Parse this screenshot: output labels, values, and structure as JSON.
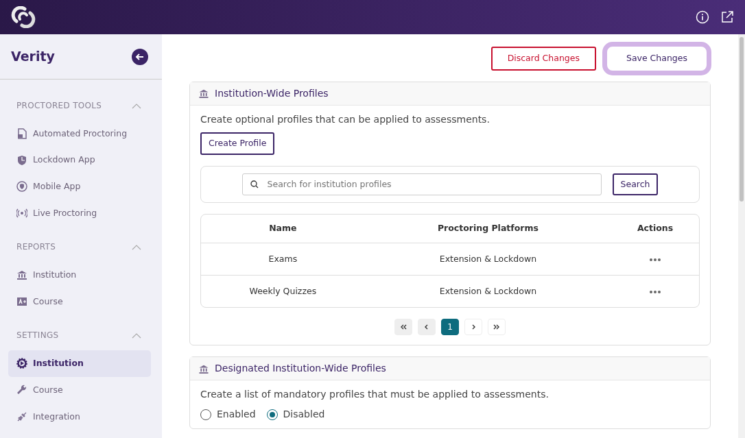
{
  "sidebar": {
    "title": "Verity",
    "sections": [
      {
        "heading": "PROCTORED TOOLS",
        "expanded": true,
        "items": [
          {
            "label": "Automated Proctoring",
            "selected": false
          },
          {
            "label": "Lockdown App",
            "selected": false
          },
          {
            "label": "Mobile App",
            "selected": false
          },
          {
            "label": "Live Proctoring",
            "selected": false
          }
        ]
      },
      {
        "heading": "REPORTS",
        "expanded": true,
        "items": [
          {
            "label": "Institution",
            "selected": false
          },
          {
            "label": "Course",
            "selected": false
          }
        ]
      },
      {
        "heading": "SETTINGS",
        "expanded": true,
        "items": [
          {
            "label": "Institution",
            "selected": true
          },
          {
            "label": "Course",
            "selected": false
          },
          {
            "label": "Integration",
            "selected": false
          }
        ]
      }
    ]
  },
  "actions": [
    {
      "label": "Discard Changes",
      "kind": "danger"
    },
    {
      "label": "Save Changes",
      "kind": "focused"
    }
  ],
  "profiles_card": {
    "title": "Institution-Wide Profiles",
    "description": "Create optional profiles that can be applied to assessments.",
    "create_button": "Create Profile",
    "search": {
      "placeholder": "Search for institution profiles",
      "button": "Search"
    },
    "table": {
      "columns": [
        "Name",
        "Proctoring Platforms",
        "Actions"
      ],
      "rows": [
        {
          "name": "Exams",
          "platforms": "Extension & Lockdown"
        },
        {
          "name": "Weekly Quizzes",
          "platforms": "Extension & Lockdown"
        }
      ]
    },
    "pagination": {
      "pages": [
        {
          "label": "1",
          "selected": true
        }
      ]
    }
  },
  "designated_card": {
    "title": "Designated Institution-Wide Profiles",
    "description": "Create a list of mandatory profiles that must be applied to assessments.",
    "options": [
      {
        "label": "Enabled",
        "selected": false
      },
      {
        "label": "Disabled",
        "selected": true
      }
    ]
  }
}
